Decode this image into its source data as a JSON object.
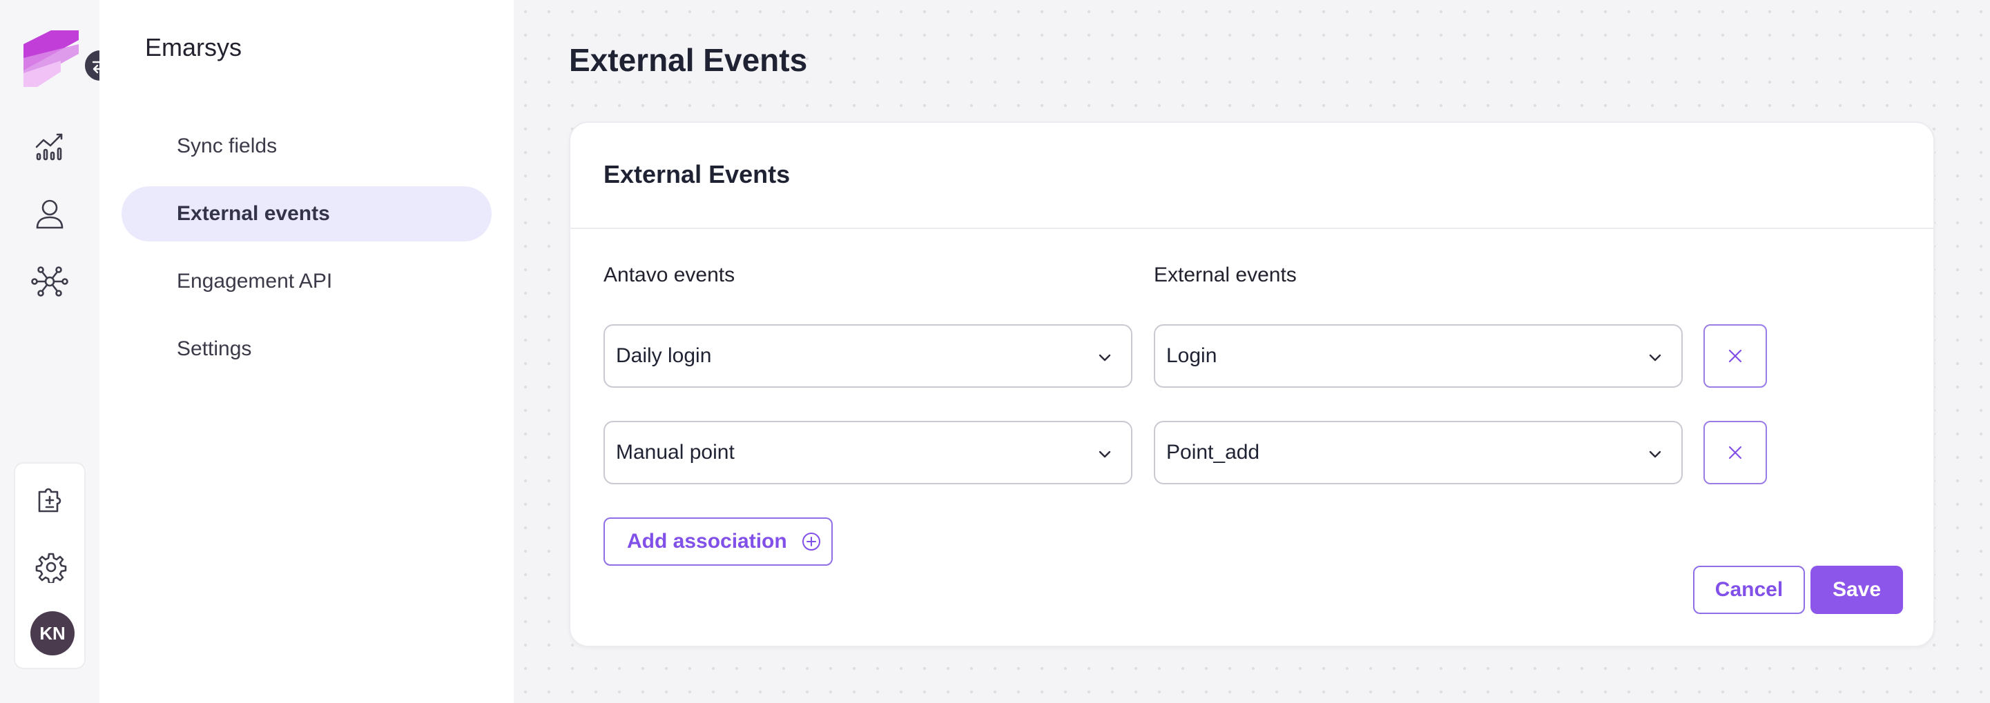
{
  "app": {
    "name": "Emarsys"
  },
  "rail": {
    "icons": [
      "logo-icon",
      "swap-icon",
      "analytics-chart-icon",
      "user-icon",
      "network-hub-icon",
      "puzzle-integration-icon",
      "gear-icon"
    ],
    "avatar_initials": "KN"
  },
  "sidebar": {
    "items": [
      {
        "label": "Sync fields",
        "active": false
      },
      {
        "label": "External events",
        "active": true
      },
      {
        "label": "Engagement API",
        "active": false
      },
      {
        "label": "Settings",
        "active": false
      }
    ]
  },
  "main": {
    "page_title": "External Events",
    "card": {
      "title": "External Events",
      "col_left_label": "Antavo events",
      "col_right_label": "External events",
      "rows": [
        {
          "antavo_event": "Daily login",
          "external_event": "Login"
        },
        {
          "antavo_event": "Manual point",
          "external_event": "Point_add"
        }
      ],
      "add_label": "Add association",
      "cancel_label": "Cancel",
      "save_label": "Save"
    }
  },
  "colors": {
    "accent": "#8c56ea",
    "active_nav_bg": "#ebe9fc",
    "avatar_bg": "#4a3c4e"
  }
}
